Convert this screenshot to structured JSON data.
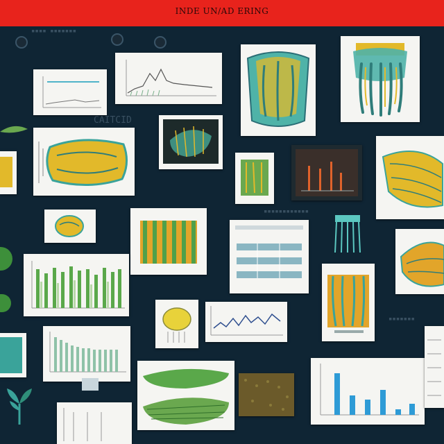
{
  "header": {
    "title": "INDE UN/AD ERING"
  },
  "background_text": {
    "mid_left": "CAITCID"
  },
  "colors": {
    "header": "#e8231c",
    "board": "#0f2534",
    "card": "#f5f5f2",
    "accent_yellow": "#e2b92a",
    "accent_teal": "#3aa39a",
    "accent_green": "#5aa84a",
    "accent_blue": "#2e9bd6"
  },
  "icons": [
    "pin-icon",
    "plant-icon",
    "leaf-icon"
  ]
}
